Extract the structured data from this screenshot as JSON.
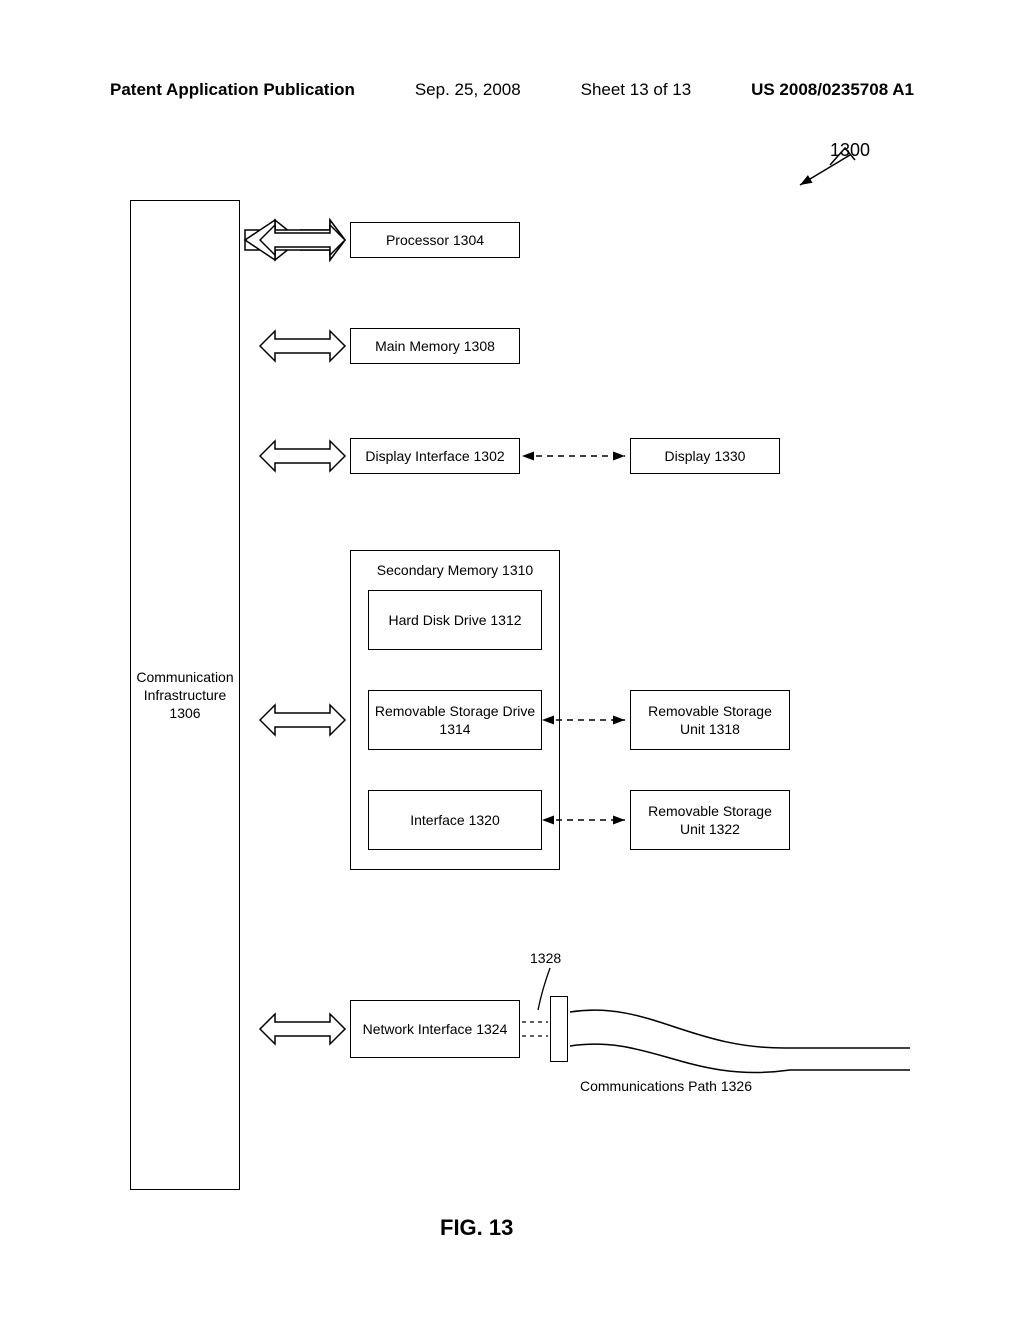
{
  "header": {
    "pub": "Patent Application Publication",
    "date": "Sep. 25, 2008",
    "sheet": "Sheet 13 of 13",
    "docnum": "US 2008/0235708 A1"
  },
  "labels": {
    "ref1300": "1300",
    "bus": "Communication Infrastructure 1306",
    "processor": "Processor 1304",
    "mainmem": "Main Memory 1308",
    "dispif": "Display Interface 1302",
    "display": "Display 1330",
    "secmem_title": "Secondary Memory 1310",
    "hdd": "Hard Disk Drive 1312",
    "rsd": "Removable Storage Drive 1314",
    "rsu1": "Removable Storage Unit 1318",
    "iface": "Interface 1320",
    "rsu2": "Removable Storage Unit 1322",
    "netif": "Network Interface 1324",
    "ref1328": "1328",
    "cpath": "Communications Path 1326",
    "fig": "FIG. 13"
  }
}
